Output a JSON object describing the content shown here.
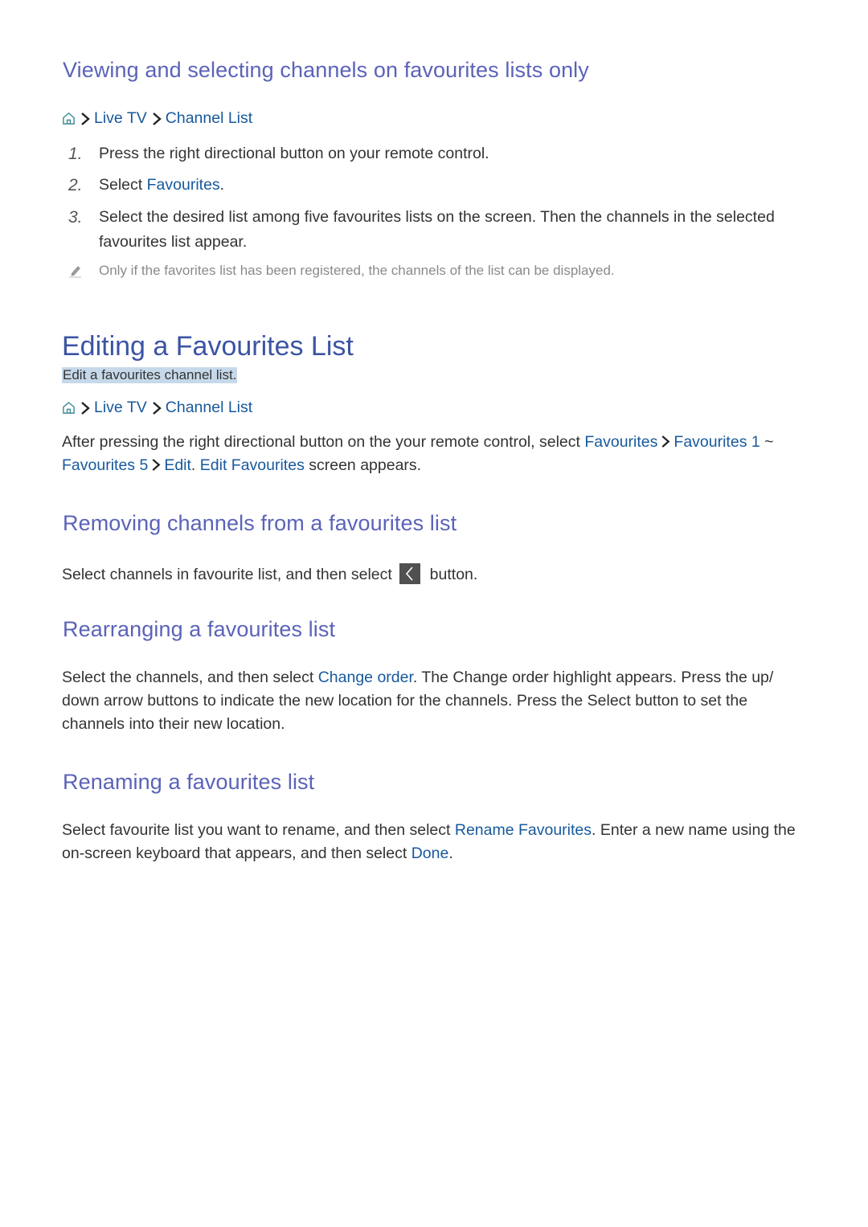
{
  "section1": {
    "title": "Viewing and selecting channels on favourites lists only",
    "breadcrumb": {
      "home_icon": "home-icon",
      "items": [
        "Live TV",
        "Channel List"
      ]
    },
    "steps": [
      {
        "num": "1.",
        "text": "Press the right directional button on your remote control."
      },
      {
        "num": "2.",
        "text_before": "Select ",
        "link": "Favourites",
        "text_after": "."
      },
      {
        "num": "3.",
        "text": "Select the desired list among five favourites lists on the screen. Then the channels in the selected favourites list appear."
      }
    ],
    "note": {
      "icon": "pencil-icon",
      "text": "Only if the favorites list has been registered, the channels of the list can be displayed."
    }
  },
  "main": {
    "title": "Editing a Favourites List",
    "summary": "Edit a favourites channel list.",
    "breadcrumb": {
      "home_icon": "home-icon",
      "items": [
        "Live TV",
        "Channel List"
      ]
    },
    "intro": {
      "text1": "After pressing the right directional button on the your remote control, select ",
      "link1": "Favourites",
      "link2": "Favourites 1",
      "tilde": " ~ ",
      "link3": "Favourites 5",
      "link4": "Edit",
      "text2": ". ",
      "link5": "Edit Favourites",
      "text3": " screen appears."
    }
  },
  "removing": {
    "title": "Removing channels from a favourites list",
    "text_before": "Select channels in favourite list, and then select",
    "button_icon": "chevron-left-icon",
    "text_after": "button."
  },
  "rearranging": {
    "title": "Rearranging a favourites list",
    "text_before": "Select the channels, and then select ",
    "link": "Change order",
    "text_after": ". The Change order highlight appears. Press the up/ down arrow buttons to indicate the new location for the channels. Press the Select button to set the channels into their new location."
  },
  "renaming": {
    "title": "Renaming a favourites list",
    "text_before": "Select favourite list you want to rename, and then select ",
    "link1": "Rename Favourites",
    "text_mid": ". Enter a new name using the on-screen keyboard that appears, and then select ",
    "link2": "Done",
    "text_after": "."
  },
  "colors": {
    "heading": "#5b63b8",
    "main_heading": "#3b54a3",
    "link": "#17599c",
    "body_text": "#333333",
    "note_text": "#8a8a8a",
    "summary_highlight": "#c6d9ea"
  }
}
